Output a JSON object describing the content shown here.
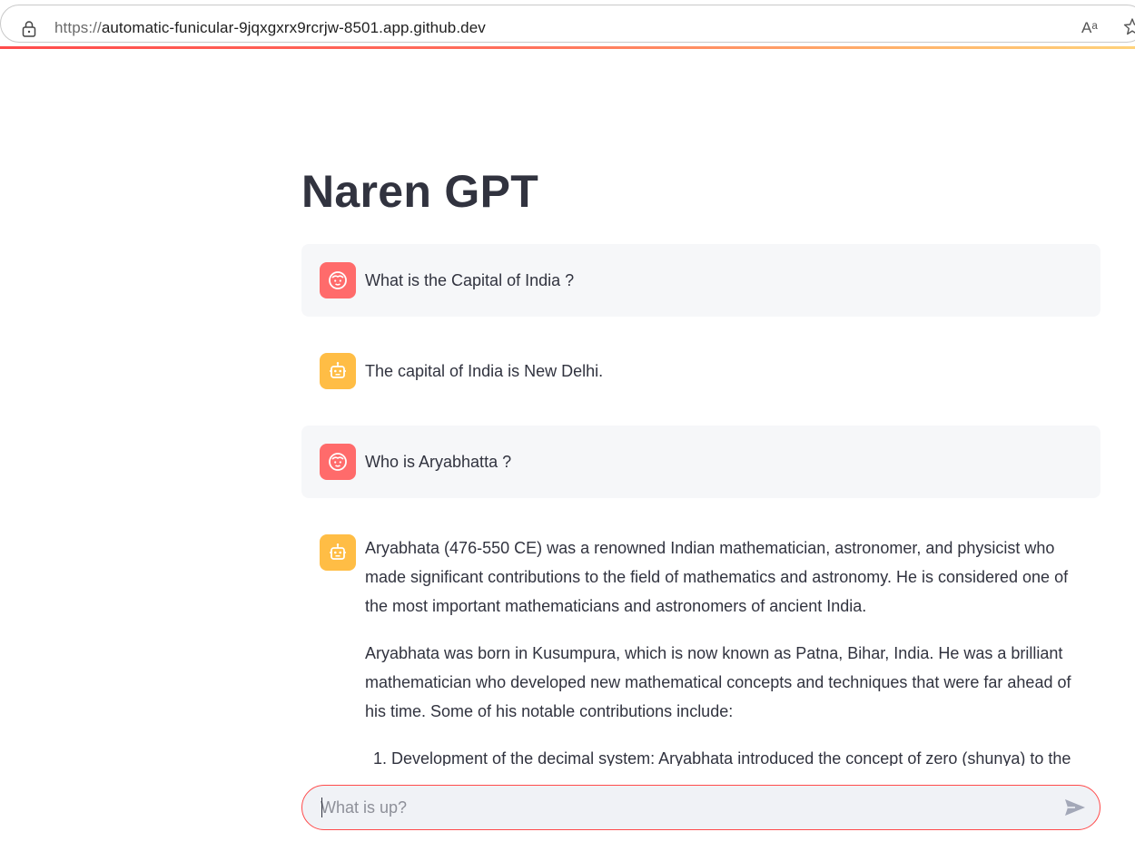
{
  "browser": {
    "url_scheme": "https://",
    "url_host": "automatic-funicular-9jqxgxrx9rcrjw-8501.app.github.dev",
    "read_aloud_label": "Aᵃ"
  },
  "app": {
    "title": "Naren GPT",
    "accent_color": "#ff4b4b"
  },
  "messages": [
    {
      "role": "user",
      "avatar_icon": "user-face-icon",
      "text": "What is the Capital of India ?"
    },
    {
      "role": "assistant",
      "avatar_icon": "robot-icon",
      "text": "The capital of India is New Delhi."
    },
    {
      "role": "user",
      "avatar_icon": "user-face-icon",
      "text": "Who is Aryabhatta ?"
    },
    {
      "role": "assistant",
      "avatar_icon": "robot-icon",
      "paragraphs": [
        "Aryabhata (476-550 CE) was a renowned Indian mathematician, astronomer, and physicist who made significant contributions to the field of mathematics and astronomy. He is considered one of the most important mathematicians and astronomers of ancient India.",
        "Aryabhata was born in Kusumpura, which is now known as Patna, Bihar, India. He was a brilliant mathematician who developed new mathematical concepts and techniques that were far ahead of his time. Some of his notable contributions include:"
      ],
      "list_items": [
        "Development of the decimal system: Aryabhata introduced the concept of zero (shunya) to the"
      ]
    }
  ],
  "chat_input": {
    "placeholder": "What is up?",
    "value": ""
  }
}
